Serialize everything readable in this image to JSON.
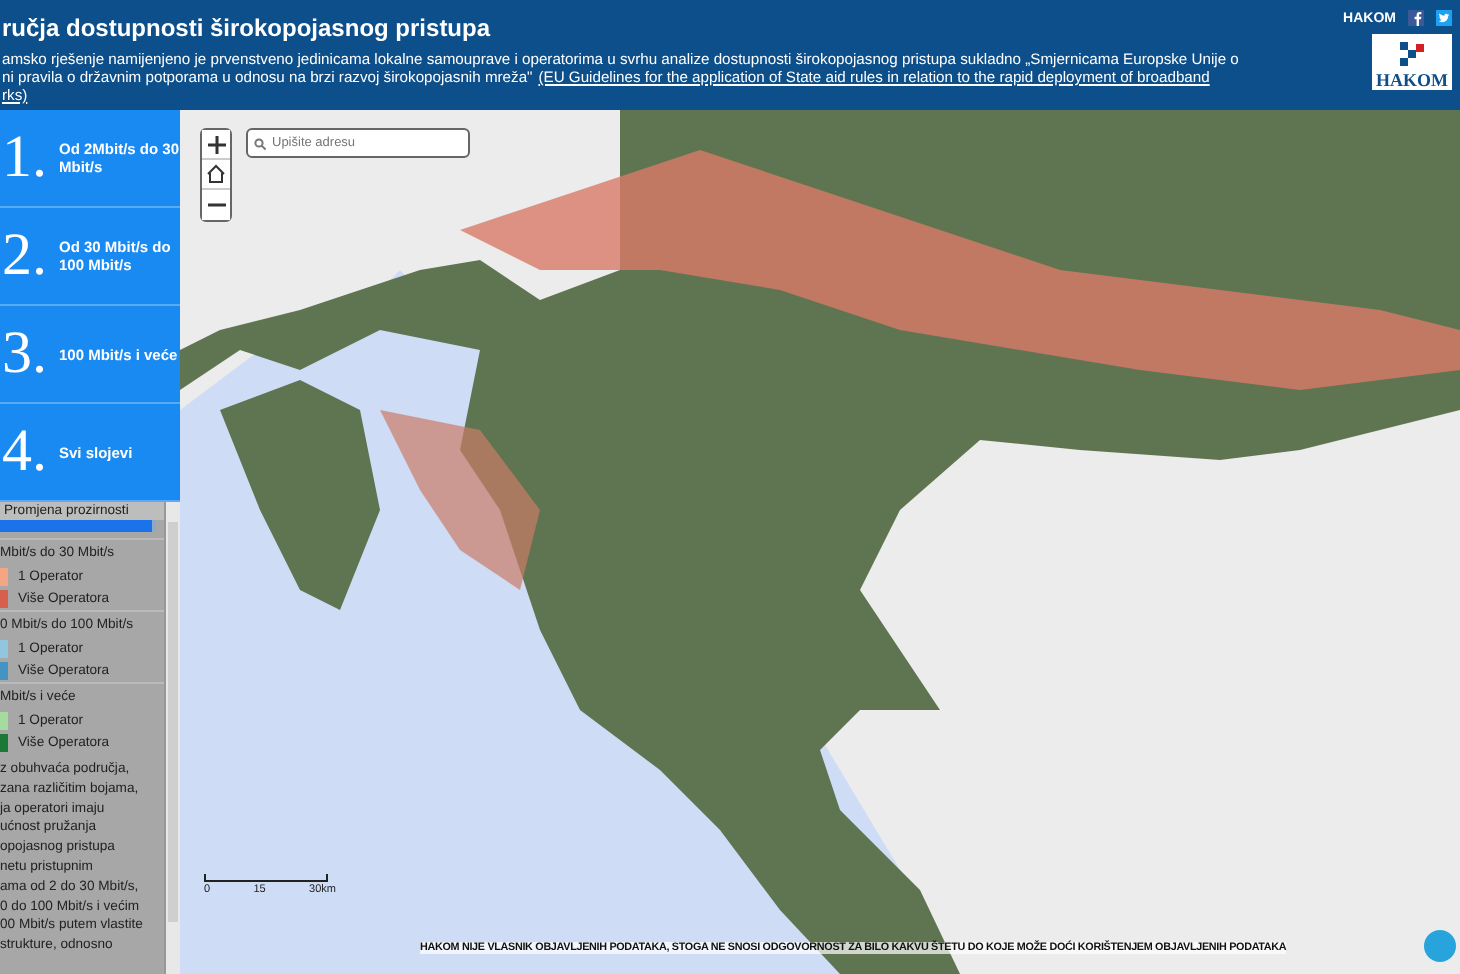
{
  "header": {
    "title": "ručja dostupnosti širokopojasnog pristupa",
    "description_lines": [
      "amsko rješenje namijenjeno je prvenstveno jedinicama lokalne samouprave i operatorima u svrhu analize dostupnosti širokopojasnog pristupa sukladno „Smjernicama Europske Unije o",
      "ni pravila o državnim potporama u odnosu na brzi razvoj širokopojasnih mreža\""
    ],
    "link_lines": [
      "(EU Guidelines for the application of State aid rules in relation to the rapid deployment of broadband",
      "rks)"
    ],
    "brand": "HAKOM",
    "logo_text": "HAKOM"
  },
  "layers": [
    {
      "number": "1.",
      "label": "Od 2Mbit/s do 30 Mbit/s",
      "selected": false
    },
    {
      "number": "2.",
      "label": "Od 30 Mbit/s do 100 Mbit/s",
      "selected": false
    },
    {
      "number": "3.",
      "label": "100 Mbit/s i veće",
      "selected": false
    },
    {
      "number": "4.",
      "label": "Svi slojevi",
      "selected": false
    }
  ],
  "legend": {
    "opacity_label": "Promjena prozirnosti",
    "opacity": {
      "level": 0.97
    },
    "groups": [
      {
        "title": "Mbit/s do 30 Mbit/s",
        "items": [
          {
            "label": "1 Operator",
            "color": "#f4a582"
          },
          {
            "label": "Više Operatora",
            "color": "#d6604d"
          }
        ]
      },
      {
        "title": "0 Mbit/s do 100 Mbit/s",
        "items": [
          {
            "label": "1 Operator",
            "color": "#92c5de"
          },
          {
            "label": "Više Operatora",
            "color": "#4393c3"
          }
        ]
      },
      {
        "title": "Mbit/s i veće",
        "items": [
          {
            "label": "1 Operator",
            "color": "#a6dba0"
          },
          {
            "label": "Više Operatora",
            "color": "#1b7837"
          }
        ]
      }
    ],
    "note_lines": [
      "z obuhvaća područja,",
      "zana različitim bojama,",
      "ja operatori imaju",
      "ućnost pružanja",
      "opojasnog pristupa",
      "netu pristupnim",
      "ama od 2 do 30 Mbit/s,",
      "0 do 100 Mbit/s i većim",
      "00 Mbit/s putem vlastite",
      "strukture, odnosno"
    ]
  },
  "map": {
    "search": {
      "placeholder": "Upišite adresu"
    },
    "scale_labels": [
      "0",
      "15",
      "30km"
    ],
    "disclaimer": "HAKOM NIJE VLASNIK OBJAVLJENIH PODATAKA, STOGA NE SNOSI ODGOVORNOST ZA BILO KAKVU ŠTETU DO KOJE MOŽE DOĆI KORIŠTENJEM OBJAVLJENIH PODATAKA"
  }
}
